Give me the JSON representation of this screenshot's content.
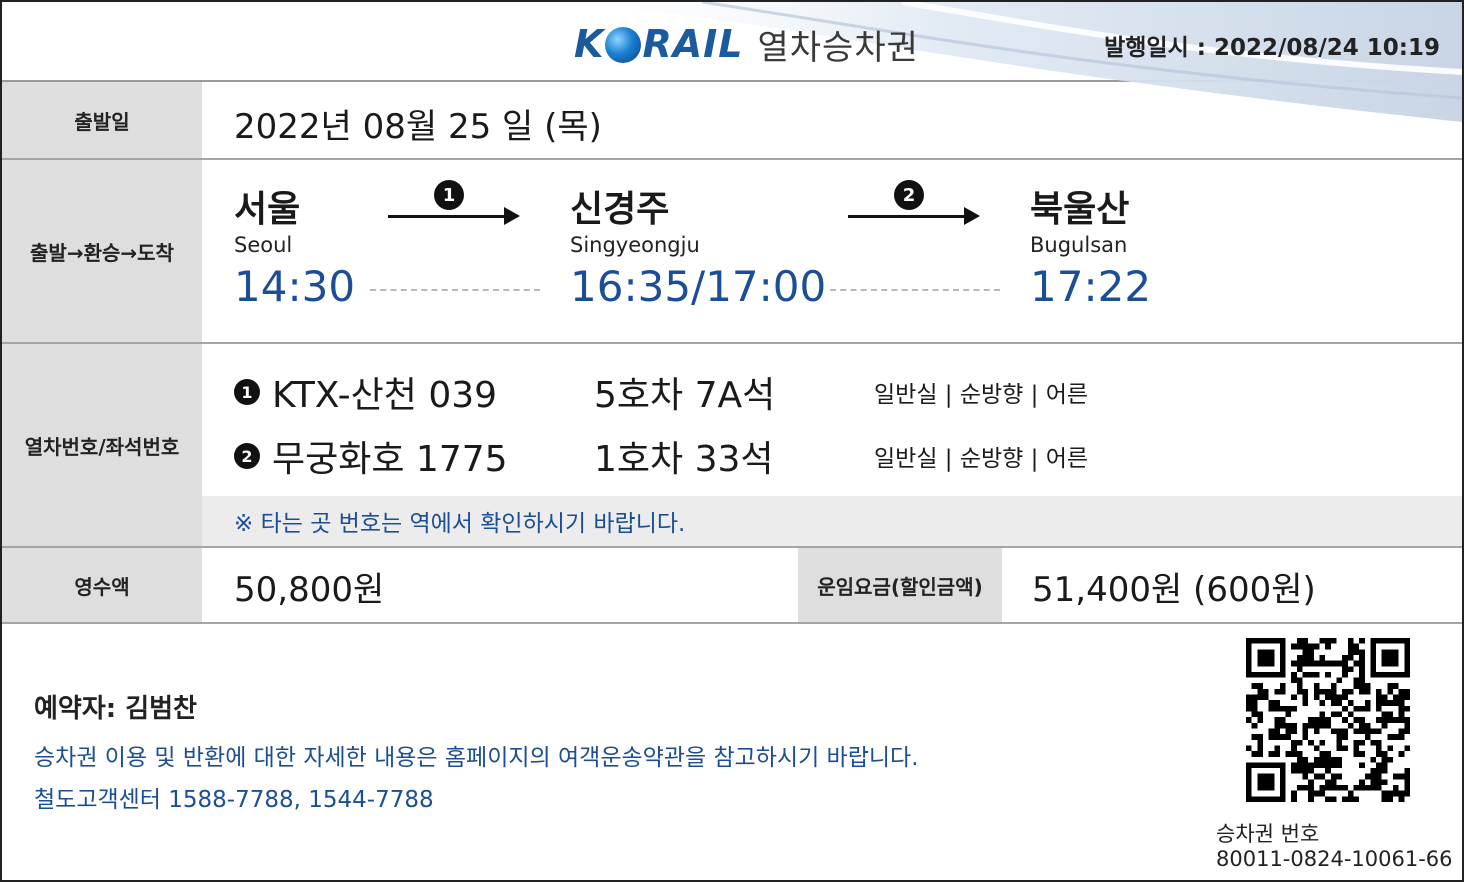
{
  "header": {
    "logo_text": "KORAIL",
    "title": "열차승차권",
    "issued": "발행일시 : 2022/08/24 10:19"
  },
  "labels": {
    "date": "출발일",
    "route": "출발→환승→도착",
    "train": "열차번호/좌석번호",
    "paid": "영수액",
    "fare": "운임요금(할인금액)"
  },
  "date": "2022년 08월 25 일 (목)",
  "route": {
    "origin": {
      "ko": "서울",
      "en": "Seoul",
      "time": "14:30"
    },
    "transfer": {
      "ko": "신경주",
      "en": "Singyeongju",
      "time": "16:35/17:00"
    },
    "destination": {
      "ko": "북울산",
      "en": "Bugulsan",
      "time": "17:22"
    },
    "leg_numbers": [
      "1",
      "2"
    ]
  },
  "trains": [
    {
      "num": "1",
      "name": "KTX-산천 039",
      "seat": "5호차 7A석",
      "class": "일반실  |  순방향 | 어른"
    },
    {
      "num": "2",
      "name": "무궁화호 1775",
      "seat": "1호차 33석",
      "class": "일반실  |  순방향 | 어른"
    }
  ],
  "notice": "※ 타는 곳 번호는 역에서 확인하시기 바랍니다.",
  "payment": {
    "paid": "50,800원",
    "fare": "51,400원 (600원)"
  },
  "footer": {
    "booker": "예약자: 김범찬",
    "info_line1": "승차권 이용 및 반환에 대한 자세한 내용은 홈페이지의 여객운송약관을 참고하시기 바랍니다.",
    "info_line2": "철도고객센터 1588-7788, 1544-7788",
    "ticket_no_label": "승차권 번호",
    "ticket_no": "80011-0824-10061-66"
  },
  "colors": {
    "brand_blue": "#1c5a9e",
    "time_blue": "#1c4e96",
    "label_gray": "#dedede"
  }
}
